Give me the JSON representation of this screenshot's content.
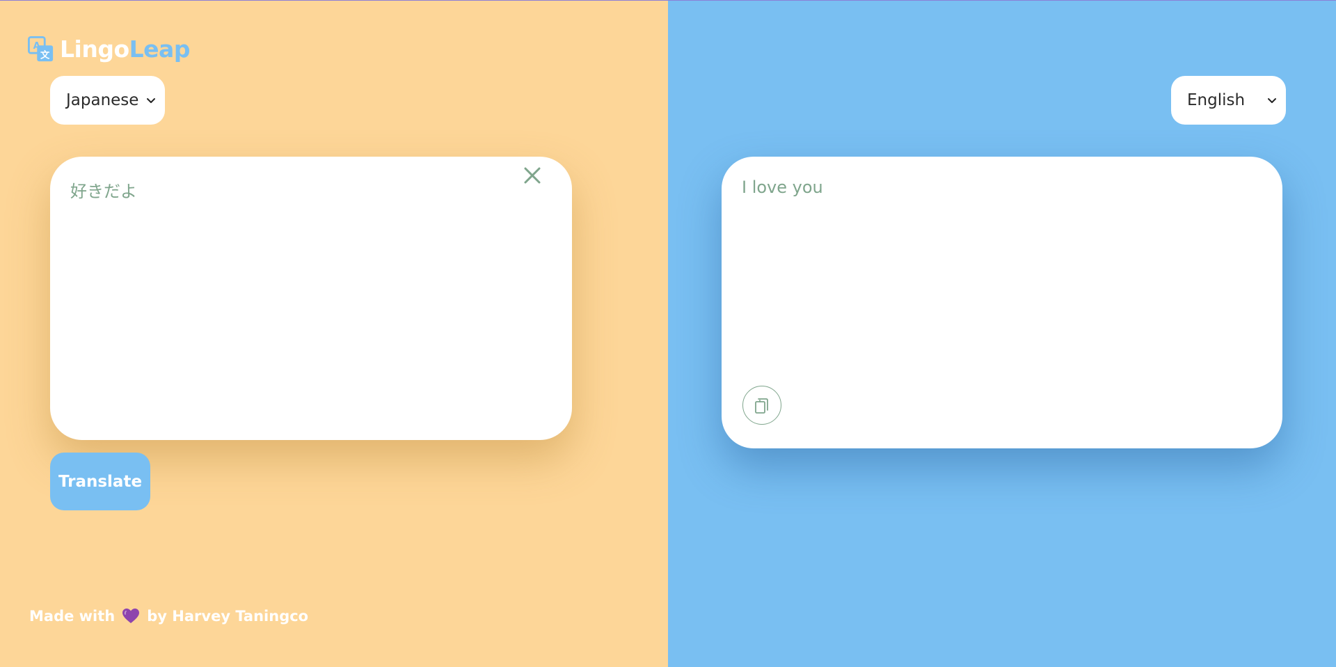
{
  "app": {
    "logo_part_1": "Lingo",
    "logo_part_2": "Leap",
    "logo_icon": "translate-icon"
  },
  "source": {
    "language": "Japanese",
    "text": "好きだよ",
    "clear_icon": "close-icon"
  },
  "target": {
    "language": "English",
    "text": "I love you",
    "copy_icon": "copy-icon"
  },
  "actions": {
    "translate_label": "Translate"
  },
  "footer": {
    "prefix": "Made with",
    "heart_icon": "purple-heart-icon",
    "suffix": "by Harvey Taningco"
  },
  "colors": {
    "left_panel": "#fdd698",
    "right_panel": "#79bff2",
    "accent": "#79bff2",
    "text_muted": "#7fa58c",
    "heart": "#8e44ad"
  }
}
